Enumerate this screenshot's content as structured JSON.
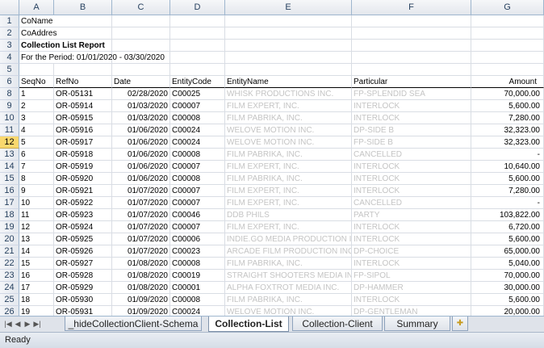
{
  "columns": [
    "A",
    "B",
    "C",
    "D",
    "E",
    "F",
    "G"
  ],
  "rows": [
    {
      "n": "1",
      "a": "CoName"
    },
    {
      "n": "2",
      "a": "CoAddres"
    },
    {
      "n": "3",
      "a": "Collection List Report"
    },
    {
      "n": "4",
      "a": "For the Period: 01/01/2020 - 03/30/2020"
    },
    {
      "n": "5"
    },
    {
      "n": "6",
      "a": "SeqNo",
      "b": "RefNo",
      "c": "Date",
      "d": "EntityCode",
      "e": "EntityName",
      "f": "Particular",
      "g": "Amount"
    },
    {
      "n": "8",
      "a": "1",
      "b": "OR-05131",
      "c": "02/28/2020",
      "d": "C00025",
      "e": "WHISK PRODUCTIONS INC.",
      "f": "FP-SPLENDID SEA",
      "g": "70,000.00"
    },
    {
      "n": "9",
      "a": "2",
      "b": "OR-05914",
      "c": "01/03/2020",
      "d": "C00007",
      "e": "FILM EXPERT, INC.",
      "f": "INTERLOCK",
      "g": "5,600.00"
    },
    {
      "n": "10",
      "a": "3",
      "b": "OR-05915",
      "c": "01/03/2020",
      "d": "C00008",
      "e": "FILM PABRIKA, INC.",
      "f": "INTERLOCK",
      "g": "7,280.00"
    },
    {
      "n": "11",
      "a": "4",
      "b": "OR-05916",
      "c": "01/06/2020",
      "d": "C00024",
      "e": "WELOVE MOTION INC.",
      "f": "DP-SIDE B",
      "g": "32,323.00"
    },
    {
      "n": "12",
      "a": "5",
      "b": "OR-05917",
      "c": "01/06/2020",
      "d": "C00024",
      "e": "WELOVE MOTION INC.",
      "f": "FP-SIDE B",
      "g": "32,323.00"
    },
    {
      "n": "13",
      "a": "6",
      "b": "OR-05918",
      "c": "01/06/2020",
      "d": "C00008",
      "e": "FILM PABRIKA, INC.",
      "f": "CANCELLED",
      "g": "-"
    },
    {
      "n": "14",
      "a": "7",
      "b": "OR-05919",
      "c": "01/06/2020",
      "d": "C00007",
      "e": "FILM EXPERT, INC.",
      "f": "INTERLOCK",
      "g": "10,640.00"
    },
    {
      "n": "15",
      "a": "8",
      "b": "OR-05920",
      "c": "01/06/2020",
      "d": "C00008",
      "e": "FILM PABRIKA, INC.",
      "f": "INTERLOCK",
      "g": "5,600.00"
    },
    {
      "n": "16",
      "a": "9",
      "b": "OR-05921",
      "c": "01/07/2020",
      "d": "C00007",
      "e": "FILM EXPERT, INC.",
      "f": "INTERLOCK",
      "g": "7,280.00"
    },
    {
      "n": "17",
      "a": "10",
      "b": "OR-05922",
      "c": "01/07/2020",
      "d": "C00007",
      "e": "FILM EXPERT, INC.",
      "f": "CANCELLED",
      "g": "-"
    },
    {
      "n": "18",
      "a": "11",
      "b": "OR-05923",
      "c": "01/07/2020",
      "d": "C00046",
      "e": "DDB PHILS",
      "f": "PARTY",
      "g": "103,822.00"
    },
    {
      "n": "19",
      "a": "12",
      "b": "OR-05924",
      "c": "01/07/2020",
      "d": "C00007",
      "e": "FILM EXPERT, INC.",
      "f": "INTERLOCK",
      "g": "6,720.00"
    },
    {
      "n": "20",
      "a": "13",
      "b": "OR-05925",
      "c": "01/07/2020",
      "d": "C00006",
      "e": "INDIE.GO MEDIA PRODUCTION INC.",
      "f": "INTERLOCK",
      "g": "5,600.00"
    },
    {
      "n": "21",
      "a": "14",
      "b": "OR-05926",
      "c": "01/07/2020",
      "d": "C00023",
      "e": "ARCADE FILM PRODUCTION INC.",
      "f": "DP-CHOICE",
      "g": "65,000.00"
    },
    {
      "n": "22",
      "a": "15",
      "b": "OR-05927",
      "c": "01/08/2020",
      "d": "C00008",
      "e": "FILM PABRIKA, INC.",
      "f": "INTERLOCK",
      "g": "5,040.00"
    },
    {
      "n": "23",
      "a": "16",
      "b": "OR-05928",
      "c": "01/08/2020",
      "d": "C00019",
      "e": "STRAIGHT SHOOTERS MEDIA INC.",
      "f": "FP-SIPOL",
      "g": "70,000.00"
    },
    {
      "n": "24",
      "a": "17",
      "b": "OR-05929",
      "c": "01/08/2020",
      "d": "C00001",
      "e": "ALPHA FOXTROT MEDIA INC.",
      "f": "DP-HAMMER",
      "g": "30,000.00"
    },
    {
      "n": "25",
      "a": "18",
      "b": "OR-05930",
      "c": "01/09/2020",
      "d": "C00008",
      "e": "FILM PABRIKA, INC.",
      "f": "INTERLOCK",
      "g": "5,600.00"
    },
    {
      "n": "26",
      "a": "19",
      "b": "OR-05931",
      "c": "01/09/2020",
      "d": "C00024",
      "e": "WELOVE MOTION INC.",
      "f": "DP-GENTLEMAN",
      "g": "20,000.00"
    }
  ],
  "selected_row": "12",
  "tabs": [
    {
      "label": "_hideCollectionClient-Schema",
      "active": false
    },
    {
      "label": "Collection-List",
      "active": true
    },
    {
      "label": "Collection-Client",
      "active": false
    },
    {
      "label": "Summary",
      "active": false
    }
  ],
  "nav_buttons": [
    "|◀",
    "◀",
    "▶",
    "▶|"
  ],
  "status": "Ready"
}
